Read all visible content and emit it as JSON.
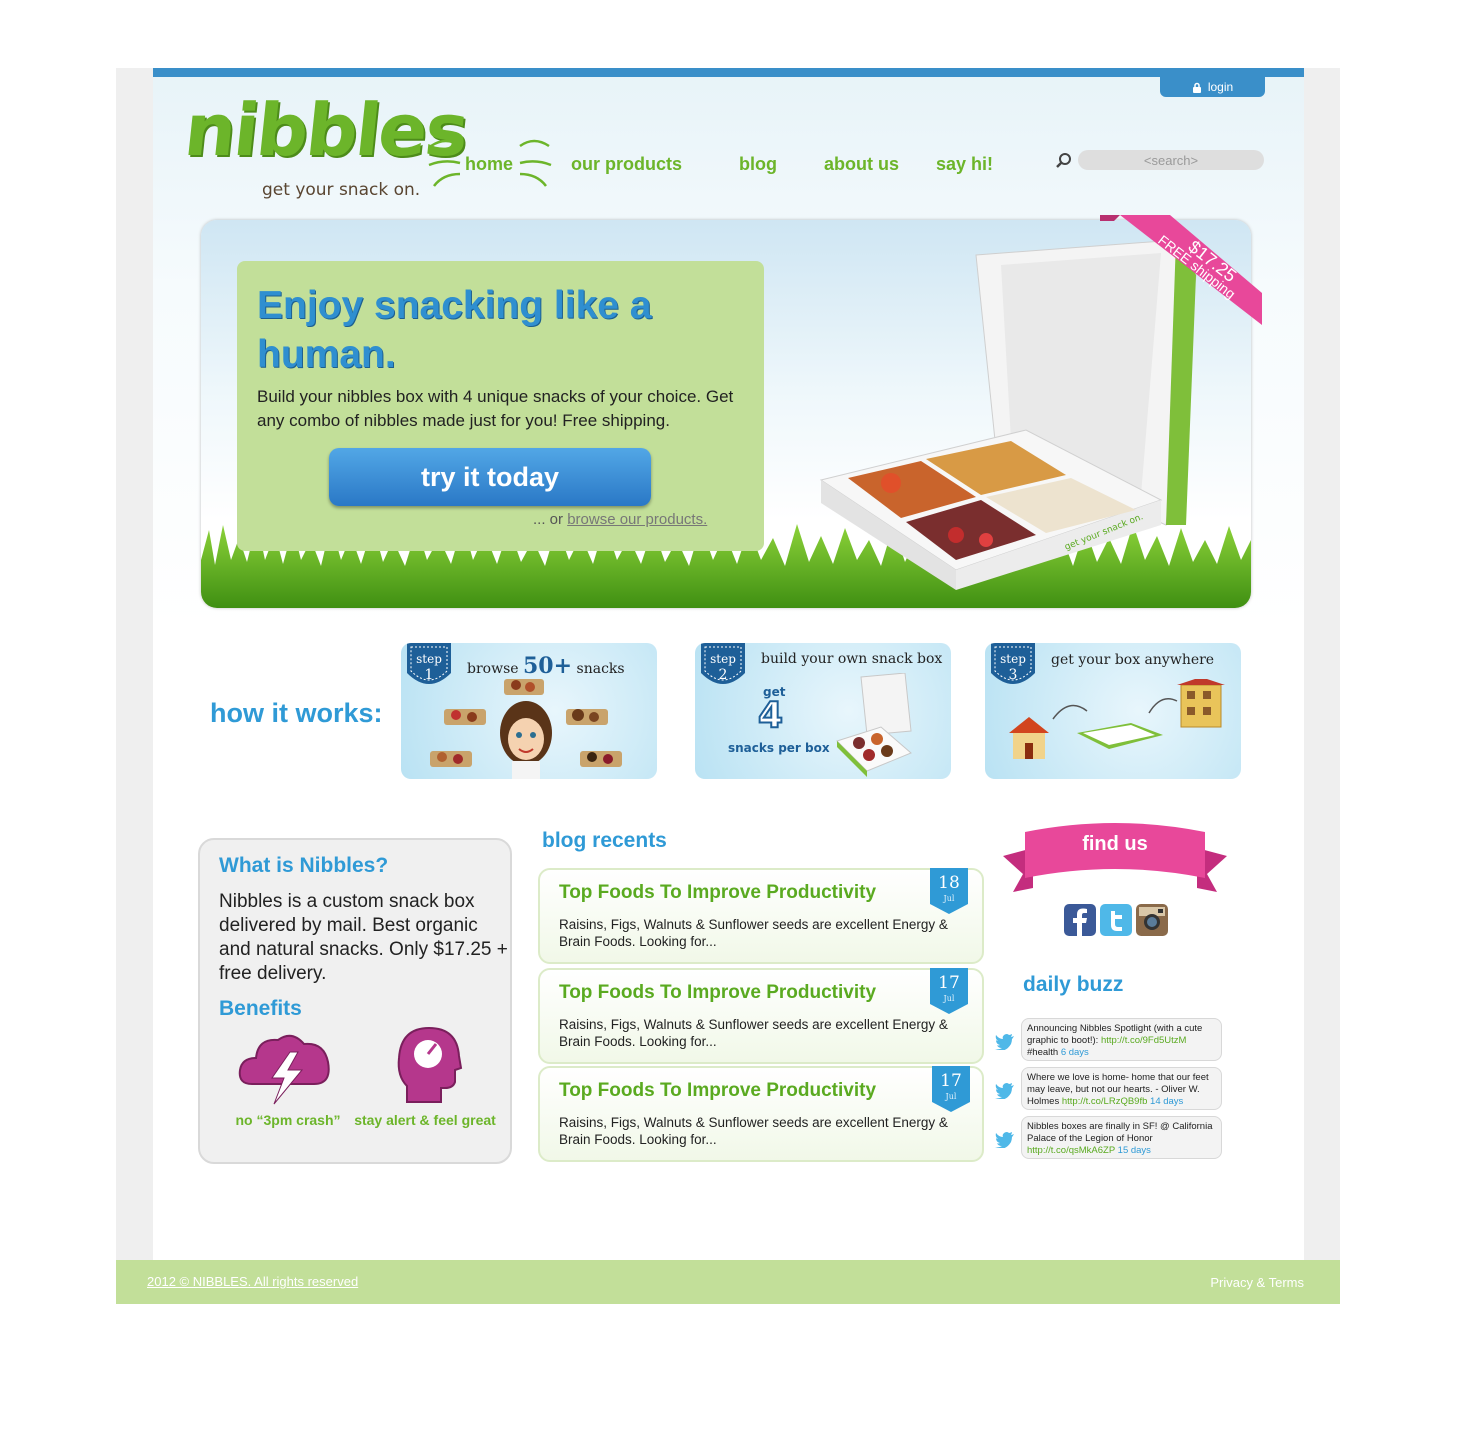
{
  "brand": {
    "name": "nibbles",
    "tagline": "get your snack on."
  },
  "header": {
    "login_label": "login",
    "nav": [
      "home",
      "our products",
      "blog",
      "about us",
      "say hi!"
    ],
    "search_placeholder": "<search>"
  },
  "hero": {
    "title": "Enjoy snacking like a human.",
    "body": "Build your nibbles box with 4 unique snacks of your choice. Get any combo of nibbles made just for you! Free shipping.",
    "cta_label": "try it today",
    "or_prefix": "... or ",
    "browse_link": "browse our products.",
    "price": "$17.25",
    "shipping": "FREE shipping",
    "box_print": "get your snack on."
  },
  "how_it_works": {
    "label": "how it works:",
    "step_word": "step",
    "steps": [
      {
        "num": "1",
        "caption_pre": "browse",
        "caption_big": "50+",
        "caption_post": "snacks"
      },
      {
        "num": "2",
        "caption": "build your own snack box",
        "get": "get",
        "big": "4",
        "sub": "snacks per box"
      },
      {
        "num": "3",
        "caption": "get your box anywhere"
      }
    ]
  },
  "about": {
    "title": "What is Nibbles?",
    "body": "Nibbles is a custom snack box delivered by mail. Best organic and natural snacks. Only $17.25 + free delivery.",
    "benefits_title": "Benefits",
    "benefits": [
      "no “3pm crash”",
      "stay alert & feel great"
    ]
  },
  "blog": {
    "title": "blog recents",
    "posts": [
      {
        "title": "Top Foods To Improve Productivity",
        "excerpt": "Raisins, Figs, Walnuts & Sunflower seeds are excellent Energy & Brain Foods. Looking for...",
        "day": "18",
        "month": "Jul"
      },
      {
        "title": "Top Foods To Improve Productivity",
        "excerpt": "Raisins, Figs, Walnuts & Sunflower seeds are excellent Energy & Brain Foods. Looking for...",
        "day": "17",
        "month": "Jul"
      },
      {
        "title": "Top Foods To Improve Productivity",
        "excerpt": "Raisins, Figs, Walnuts & Sunflower seeds are excellent Energy & Brain Foods. Looking for...",
        "day": "17",
        "month": "Jul"
      }
    ]
  },
  "find_us": {
    "label": "find us",
    "icons": [
      "facebook-icon",
      "twitter-icon",
      "instagram-icon"
    ]
  },
  "buzz": {
    "title": "daily buzz",
    "tweets": [
      {
        "text": "Announcing Nibbles Spotlight (with a cute graphic to boot!): ",
        "link": "http://t.co/9Fd5UtzM",
        "after": " #health ",
        "time": "6 days"
      },
      {
        "text": "Where we love is home- home that our feet may leave, but not our hearts. - Oliver W. Holmes ",
        "link": "http://t.co/LRzQB9fb",
        "after": " ",
        "time": "14 days"
      },
      {
        "text": "Nibbles boxes are finally in SF! @ California Palace of the Legion of Honor ",
        "link": "http://t.co/qsMkA6ZP",
        "after": " ",
        "time": "15 days"
      }
    ]
  },
  "footer": {
    "copyright": "2012 © NIBBLES. All rights reserved",
    "privacy": "Privacy & Terms"
  },
  "colors": {
    "brand_green": "#6cb52a",
    "accent_blue": "#2f9ad6",
    "ribbon_pink": "#e8489a",
    "footer_green": "#c2df99"
  }
}
